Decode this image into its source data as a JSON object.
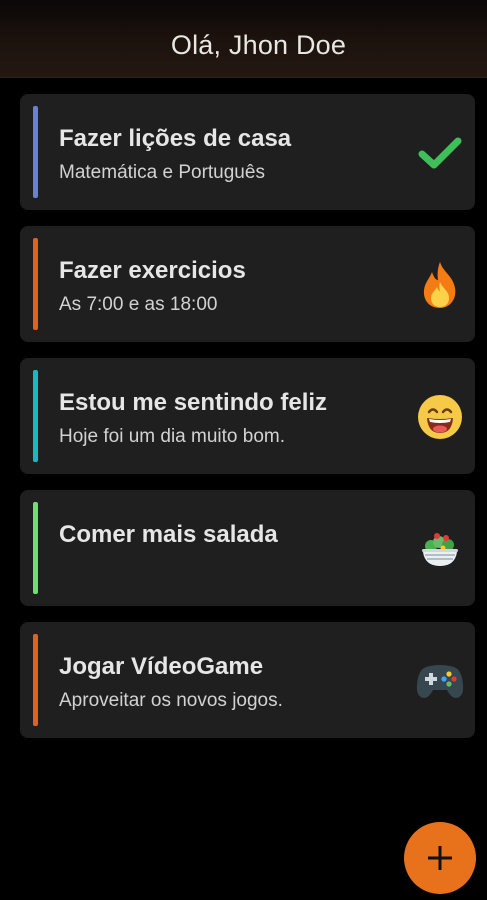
{
  "header": {
    "title": "Olá, Jhon Doe"
  },
  "tasks": [
    {
      "title": "Fazer lições de casa",
      "subtitle": "Matemática e Português",
      "color": "#6a7fd9",
      "icon": "checkmark-icon"
    },
    {
      "title": "Fazer exercicios",
      "subtitle": "As 7:00 e as 18:00",
      "color": "#e0621f",
      "icon": "fire-icon"
    },
    {
      "title": "Estou me sentindo feliz",
      "subtitle": "Hoje foi um dia muito bom.",
      "color": "#19b9c4",
      "icon": "laughing-face-icon"
    },
    {
      "title": "Comer mais salada",
      "subtitle": "",
      "color": "#6ee06e",
      "icon": "salad-bowl-icon"
    },
    {
      "title": "Jogar VídeoGame",
      "subtitle": "Aproveitar os novos jogos.",
      "color": "#e0621f",
      "icon": "gamepad-icon"
    }
  ],
  "fab": {
    "icon": "plus-icon",
    "color": "#e8721c"
  }
}
